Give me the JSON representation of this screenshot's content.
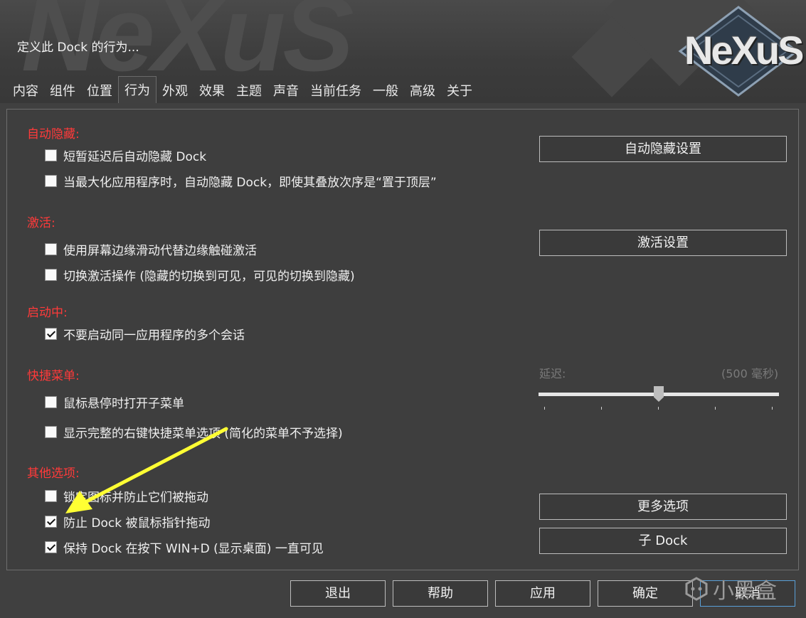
{
  "header": {
    "background_text": "NeXuS",
    "title": "定义此 Dock 的行为...",
    "logo_text": "NeXuS"
  },
  "tabs": [
    {
      "label": "内容",
      "active": false
    },
    {
      "label": "组件",
      "active": false
    },
    {
      "label": "位置",
      "active": false
    },
    {
      "label": "行为",
      "active": true
    },
    {
      "label": "外观",
      "active": false
    },
    {
      "label": "效果",
      "active": false
    },
    {
      "label": "主题",
      "active": false
    },
    {
      "label": "声音",
      "active": false
    },
    {
      "label": "当前任务",
      "active": false
    },
    {
      "label": "一般",
      "active": false
    },
    {
      "label": "高级",
      "active": false
    },
    {
      "label": "关于",
      "active": false
    }
  ],
  "sections": {
    "autohide": {
      "title": "自动隐藏:",
      "options": [
        {
          "label": "短暂延迟后自动隐藏 Dock",
          "checked": false
        },
        {
          "label": "当最大化应用程序时，自动隐藏 Dock，即使其叠放次序是“置于顶层”",
          "checked": false
        }
      ],
      "button": "自动隐藏设置"
    },
    "activation": {
      "title": "激活:",
      "options": [
        {
          "label": "使用屏幕边缘滑动代替边缘触碰激活",
          "checked": false
        },
        {
          "label": "切换激活操作 (隐藏的切换到可见，可见的切换到隐藏)",
          "checked": false
        }
      ],
      "button": "激活设置"
    },
    "launching": {
      "title": "启动中:",
      "options": [
        {
          "label": "不要启动同一应用程序的多个会话",
          "checked": true
        }
      ]
    },
    "quickmenu": {
      "title": "快捷菜单:",
      "options": [
        {
          "label": "鼠标悬停时打开子菜单",
          "checked": false
        },
        {
          "label": "显示完整的右键快捷菜单选项 (简化的菜单不予选择)",
          "checked": false
        }
      ],
      "delay_label": "延迟:",
      "delay_value": "(500 毫秒)",
      "delay_fraction": 0.5
    },
    "other": {
      "title": "其他选项:",
      "options": [
        {
          "label": "锁定图标并防止它们被拖动",
          "checked": false
        },
        {
          "label": "防止 Dock 被鼠标指针拖动",
          "checked": true
        },
        {
          "label": "保持 Dock 在按下 WIN+D (显示桌面) 一直可见",
          "checked": true
        }
      ],
      "buttons": [
        "更多选项",
        "子 Dock"
      ]
    }
  },
  "footer": {
    "exit": "退出",
    "help": "帮助",
    "apply": "应用",
    "ok": "确定",
    "cancel": "取消"
  },
  "watermark": "小黑盒",
  "colors": {
    "section_title": "#ff3a3a",
    "annotation_arrow": "#ffff33",
    "background": "#404040"
  }
}
